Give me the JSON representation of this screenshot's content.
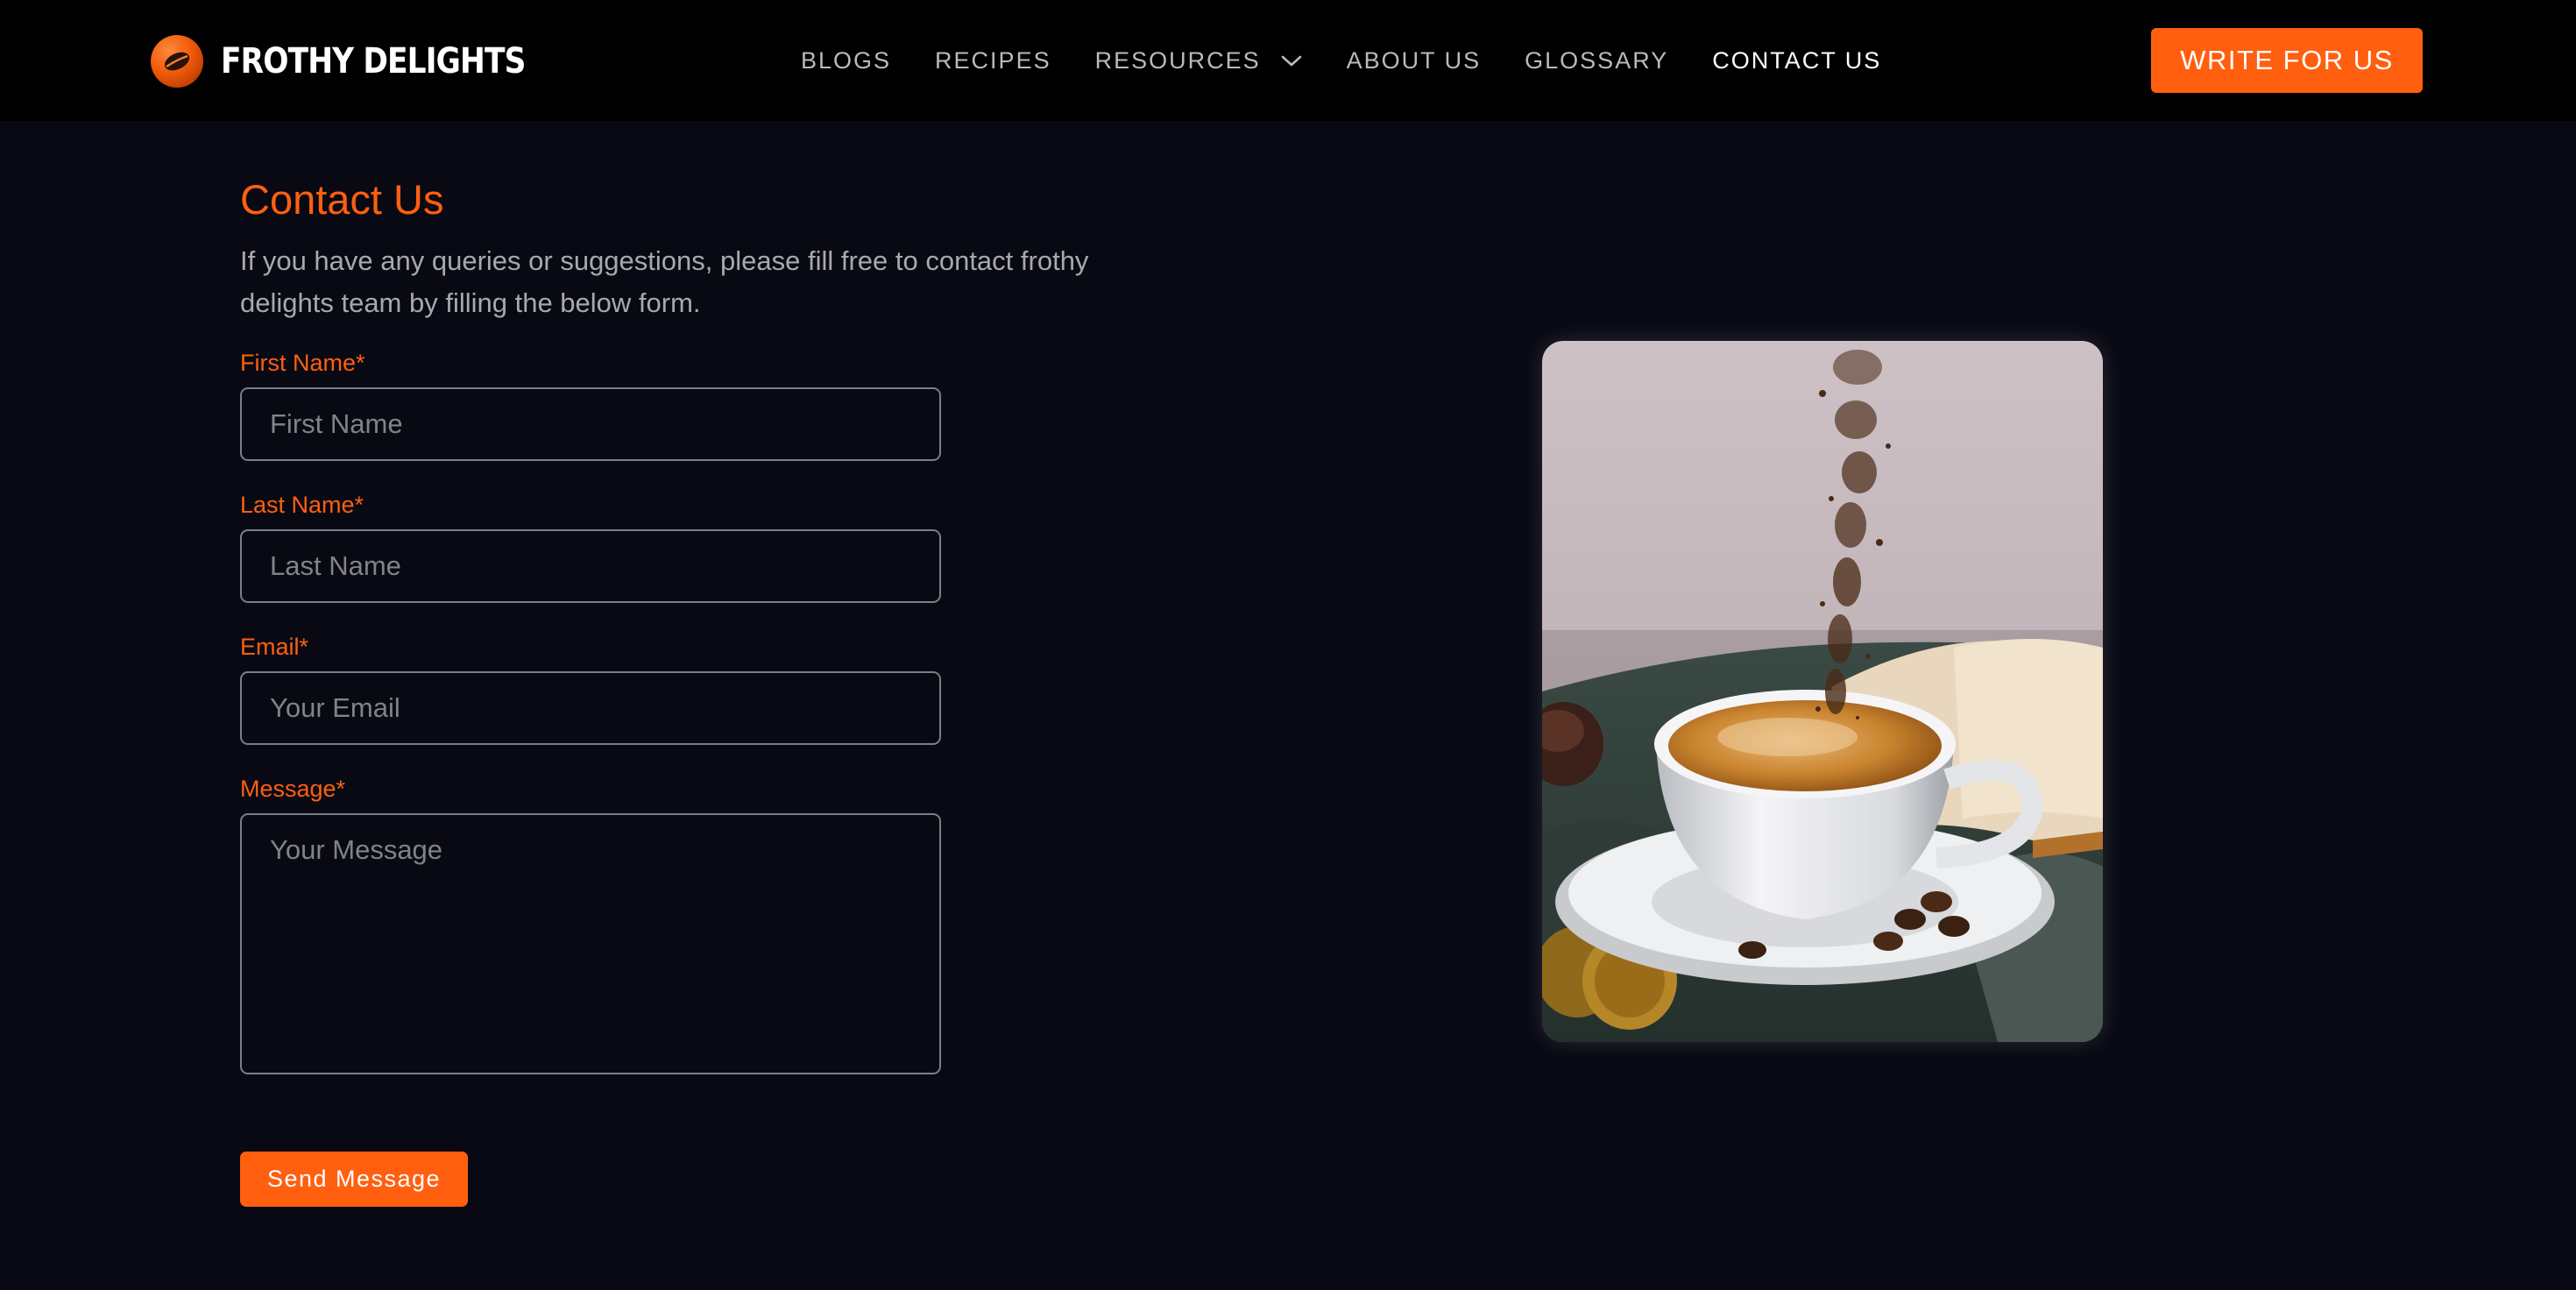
{
  "header": {
    "brand_name": "FROTHY DELIGHTS",
    "brand_icon": "coffee-bean-icon",
    "nav": [
      {
        "label": "BLOGS"
      },
      {
        "label": "RECIPES"
      },
      {
        "label": "RESOURCES",
        "has_dropdown": true,
        "icon": "chevron-down-icon"
      },
      {
        "label": "ABOUT US"
      },
      {
        "label": "GLOSSARY"
      },
      {
        "label": "CONTACT US",
        "active": true
      }
    ],
    "cta_label": "WRITE FOR US"
  },
  "contact": {
    "title": "Contact Us",
    "intro": "If you have any queries or suggestions, please fill free to contact frothy delights team by filling the below form.",
    "fields": {
      "first_name": {
        "label": "First Name*",
        "placeholder": "First Name",
        "value": ""
      },
      "last_name": {
        "label": "Last Name*",
        "placeholder": "Last Name",
        "value": ""
      },
      "email": {
        "label": "Email*",
        "placeholder": "Your Email",
        "value": ""
      },
      "message": {
        "label": "Message*",
        "placeholder": "Your Message",
        "value": ""
      }
    },
    "submit_label": "Send Message"
  },
  "colors": {
    "accent": "#ff5f0f",
    "header_background": "#000000",
    "page_background": "#080913",
    "active_nav": "#ffffff",
    "nav_text": "#b9b9bf"
  }
}
